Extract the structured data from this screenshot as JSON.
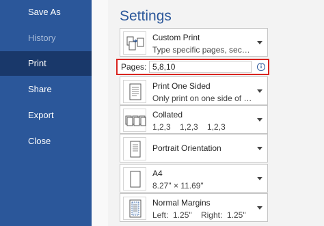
{
  "sidebar": {
    "items": [
      {
        "label": "Save As"
      },
      {
        "label": "History"
      },
      {
        "label": "Print"
      },
      {
        "label": "Share"
      },
      {
        "label": "Export"
      },
      {
        "label": "Close"
      }
    ]
  },
  "settings": {
    "title": "Settings",
    "print_range": {
      "title": "Custom Print",
      "subtitle": "Type specific pages, section...",
      "icon": "custom-print-icon"
    },
    "pages": {
      "label": "Pages:",
      "value": "5,8,10",
      "info_icon": "info-icon"
    },
    "sides": {
      "title": "Print One Sided",
      "subtitle": "Only print on one side of th...",
      "icon": "one-sided-icon"
    },
    "collation": {
      "title": "Collated",
      "subtitle": "1,2,3    1,2,3    1,2,3",
      "icon": "collated-icon"
    },
    "orientation": {
      "title": "Portrait Orientation",
      "icon": "portrait-icon"
    },
    "paper": {
      "title": "A4",
      "subtitle": "8.27\" × 11.69\"",
      "icon": "paper-size-icon"
    },
    "margins": {
      "title": "Normal Margins",
      "subtitle": "Left:  1.25\"    Right:  1.25\"",
      "icon": "margins-icon"
    }
  },
  "colors": {
    "sidebar": "#2b579a",
    "sidebar_active": "#19386a",
    "accent": "#2b579a",
    "highlight_border": "#d9241f"
  }
}
